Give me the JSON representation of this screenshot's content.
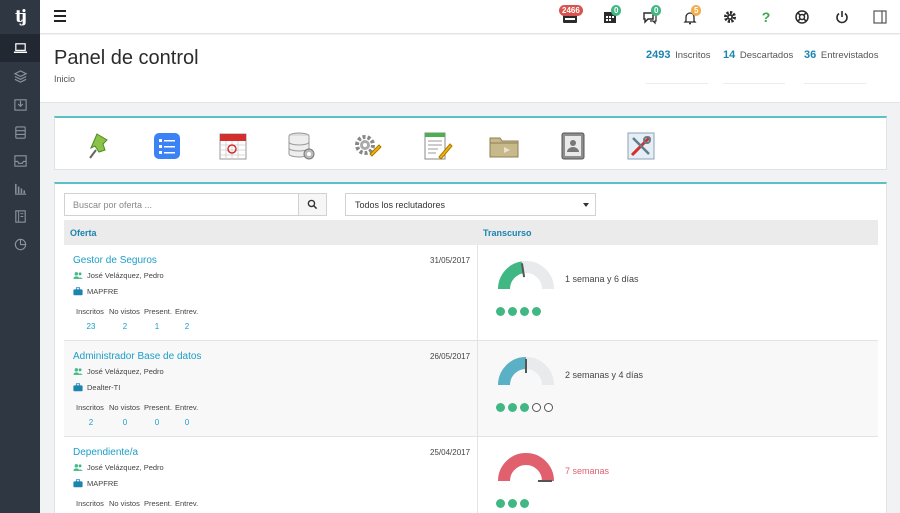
{
  "sidebar": {
    "logo": "tj",
    "items": [
      {
        "name": "laptop-icon",
        "active": true
      },
      {
        "name": "layers-icon",
        "active": false
      },
      {
        "name": "inbox-download-icon",
        "active": false
      },
      {
        "name": "database-icon",
        "active": false
      },
      {
        "name": "inbox-icon",
        "active": false
      },
      {
        "name": "bar-chart-icon",
        "active": false
      },
      {
        "name": "book-icon",
        "active": false
      },
      {
        "name": "pie-chart-icon",
        "active": false
      }
    ]
  },
  "topbar": {
    "badges": {
      "inbox": "2466",
      "calendar": "0",
      "chat": "0",
      "bell": "5"
    },
    "help": "?",
    "colors": {
      "red": "#d9534f",
      "green": "#41b883",
      "orange": "#f0ad4e"
    }
  },
  "header": {
    "title": "Panel de control",
    "breadcrumb": "Inicio",
    "stats": [
      {
        "value": "2493",
        "label": "Inscritos"
      },
      {
        "value": "14",
        "label": "Descartados"
      },
      {
        "value": "36",
        "label": "Entrevistados"
      }
    ]
  },
  "modules": [
    "pin-icon",
    "checklist-icon",
    "calendar-icon",
    "database-settings-icon",
    "gears-icon",
    "document-edit-icon",
    "folder-icon",
    "contacts-book-icon",
    "tools-icon"
  ],
  "filters": {
    "search_placeholder": "Buscar por oferta ...",
    "recruiter_selected": "Todos los reclutadores"
  },
  "table": {
    "headers": {
      "offer": "Oferta",
      "elapsed": "Transcurso"
    },
    "stat_labels": [
      "Inscritos",
      "No vistos",
      "Present.",
      "Entrev."
    ],
    "rows": [
      {
        "title": "Gestor de Seguros",
        "date": "31/05/2017",
        "recruiter": "José Velázquez, Pedro",
        "company": "MAPFRE",
        "stats": [
          "23",
          "2",
          "1",
          "2"
        ],
        "duration": "1 semana y 6 días",
        "gauge_level": 0.45,
        "gauge_color": "#41b883",
        "duration_color": "#444444",
        "dots_filled": 4,
        "dots_empty": 0
      },
      {
        "title": "Administrador Base de datos",
        "date": "26/05/2017",
        "recruiter": "José Velázquez, Pedro",
        "company": "Dealter-TI",
        "stats": [
          "2",
          "0",
          "0",
          "0"
        ],
        "duration": "2 semanas y 4 días",
        "gauge_level": 0.5,
        "gauge_color": "#5ab0c4",
        "duration_color": "#444444",
        "dots_filled": 3,
        "dots_empty": 2
      },
      {
        "title": "Dependiente/a",
        "date": "25/04/2017",
        "recruiter": "José Velázquez, Pedro",
        "company": "MAPFRE",
        "stats": [
          "",
          "",
          "",
          ""
        ],
        "duration": "7 semanas",
        "gauge_level": 1.0,
        "gauge_color": "#e0606e",
        "duration_color": "#e0606e",
        "dots_filled": 3,
        "dots_empty": 0
      }
    ]
  }
}
